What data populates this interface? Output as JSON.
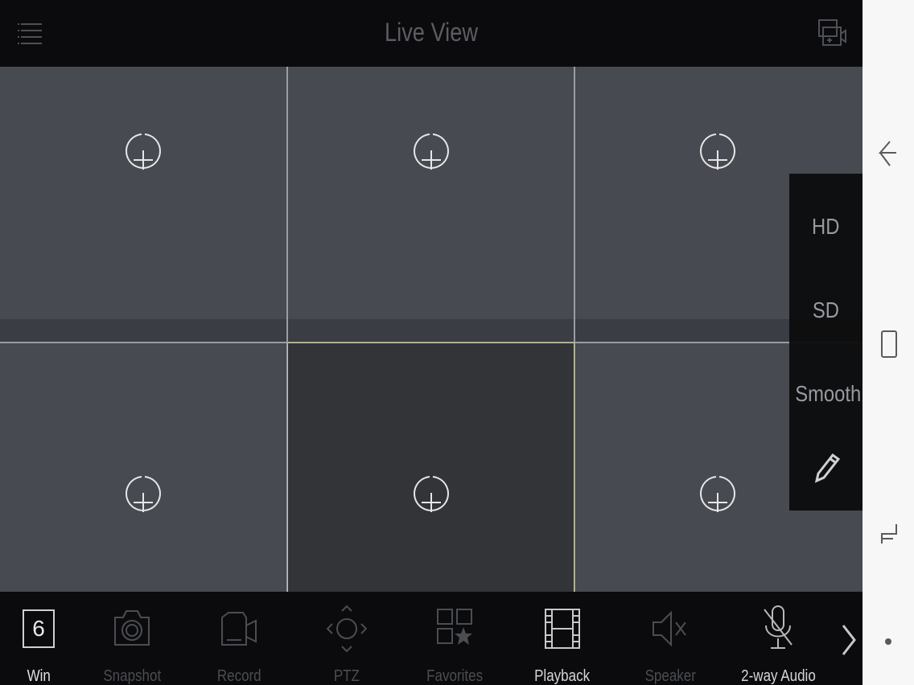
{
  "header": {
    "title": "Live View",
    "menu_icon": "menu-icon",
    "multi_icon": "multi-window-icon"
  },
  "grid": {
    "cells": [
      {
        "icon": "add-camera-icon",
        "selected": false
      },
      {
        "icon": "add-camera-icon",
        "selected": false
      },
      {
        "icon": "add-camera-icon",
        "selected": false
      },
      {
        "icon": "add-camera-icon",
        "selected": false
      },
      {
        "icon": "add-camera-icon",
        "selected": true
      },
      {
        "icon": "add-camera-icon",
        "selected": false
      }
    ]
  },
  "quality": {
    "options": [
      "HD",
      "SD",
      "Smooth"
    ],
    "edit_icon": "pencil-icon"
  },
  "toolbar": {
    "win_count": "6",
    "items": [
      {
        "label": "Win",
        "icon": "window-count-icon"
      },
      {
        "label": "Snapshot",
        "icon": "camera-icon"
      },
      {
        "label": "Record",
        "icon": "video-camera-icon"
      },
      {
        "label": "PTZ",
        "icon": "ptz-icon"
      },
      {
        "label": "Favorites",
        "icon": "favorites-icon"
      },
      {
        "label": "Playback",
        "icon": "film-icon"
      },
      {
        "label": "Speaker",
        "icon": "speaker-mute-icon"
      },
      {
        "label": "2-way Audio",
        "icon": "mic-off-icon"
      }
    ],
    "next_icon": "chevron-right-icon"
  },
  "system_nav": {
    "back_icon": "back-icon",
    "home_icon": "home-icon",
    "recents_icon": "recents-icon",
    "dot_icon": "dot-icon"
  },
  "colors": {
    "cell_bg": "#474a51",
    "cell_selected_bg": "#333438",
    "selected_border": "#c7c48a",
    "topbar_bg": "#0b0b0d"
  }
}
